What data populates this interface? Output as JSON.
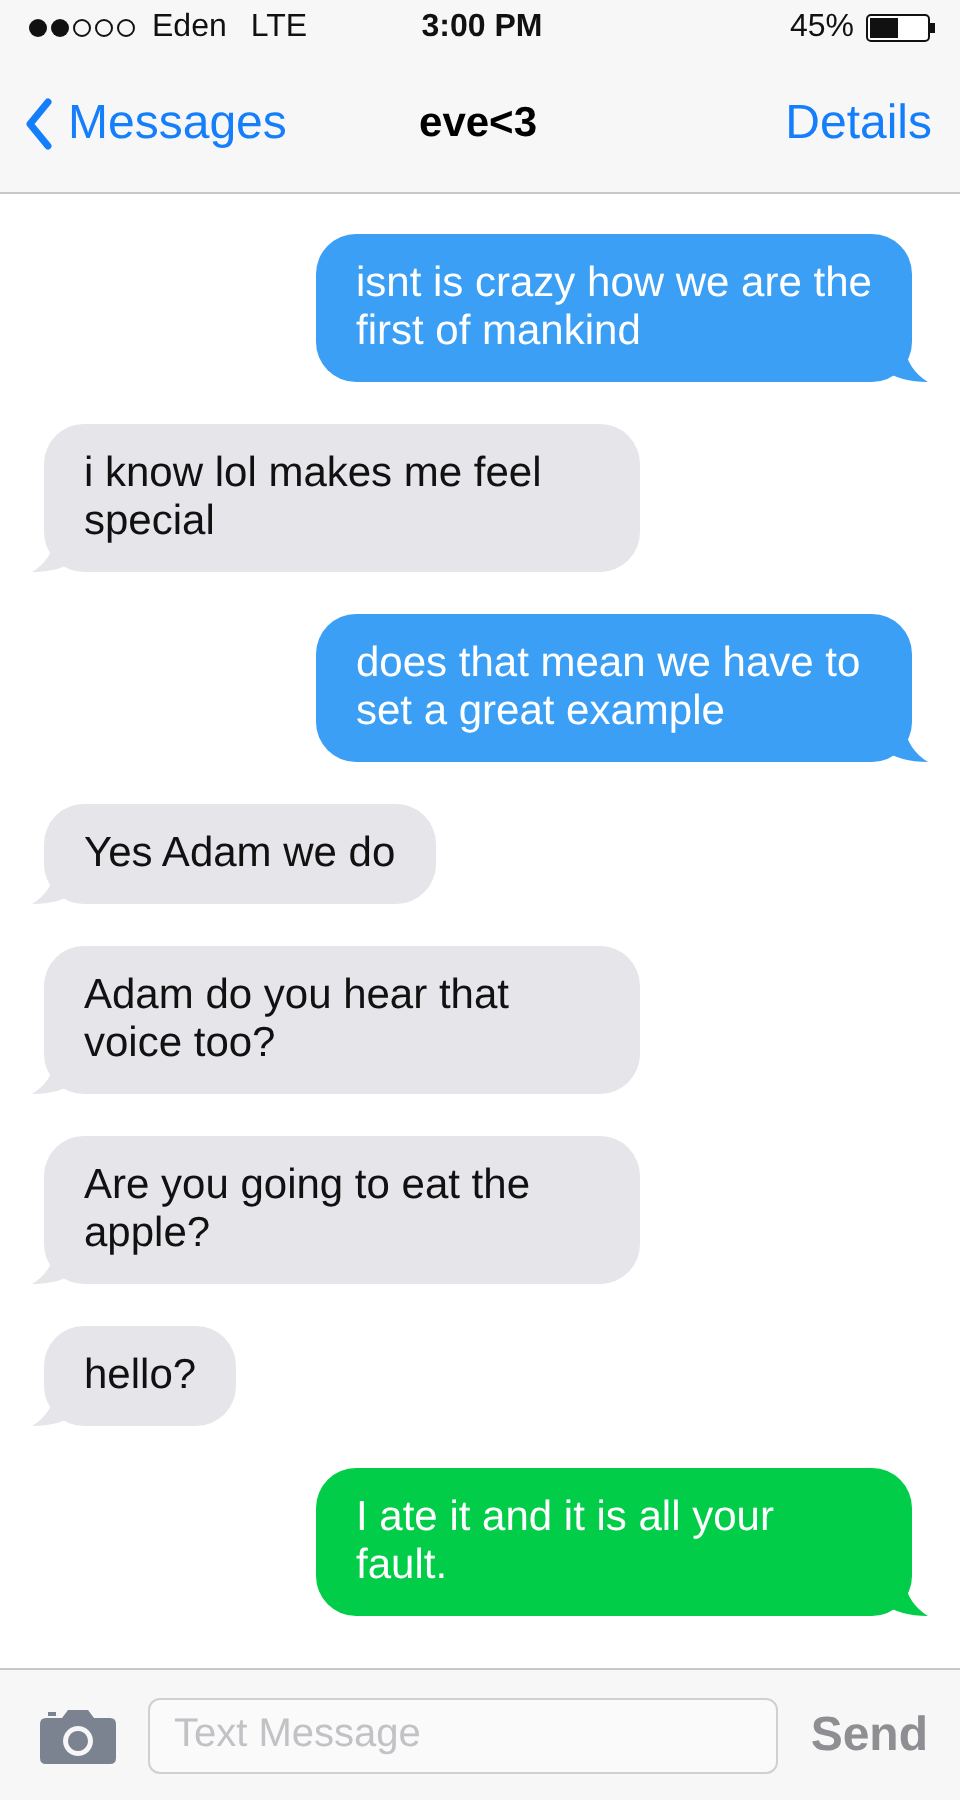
{
  "status_bar": {
    "carrier": "Eden",
    "network": "LTE",
    "time": "3:00 PM",
    "battery": "45%"
  },
  "nav": {
    "back": "Messages",
    "title": "eve<3",
    "action": "Details"
  },
  "messages": [
    {
      "kind": "imessage",
      "text": "isnt is crazy how we are the first of mankind"
    },
    {
      "kind": "received",
      "text": "i know lol makes me feel special"
    },
    {
      "kind": "imessage",
      "text": "does that mean we have to set a great example"
    },
    {
      "kind": "received",
      "text": "Yes Adam we do"
    },
    {
      "kind": "received",
      "text": "Adam do you hear that voice too?"
    },
    {
      "kind": "received",
      "text": "Are you going to eat the apple?"
    },
    {
      "kind": "received",
      "text": "hello?"
    },
    {
      "kind": "sms",
      "text": "I ate it and it is all your fault."
    }
  ],
  "composer": {
    "placeholder": "Text Message",
    "send": "Send"
  }
}
